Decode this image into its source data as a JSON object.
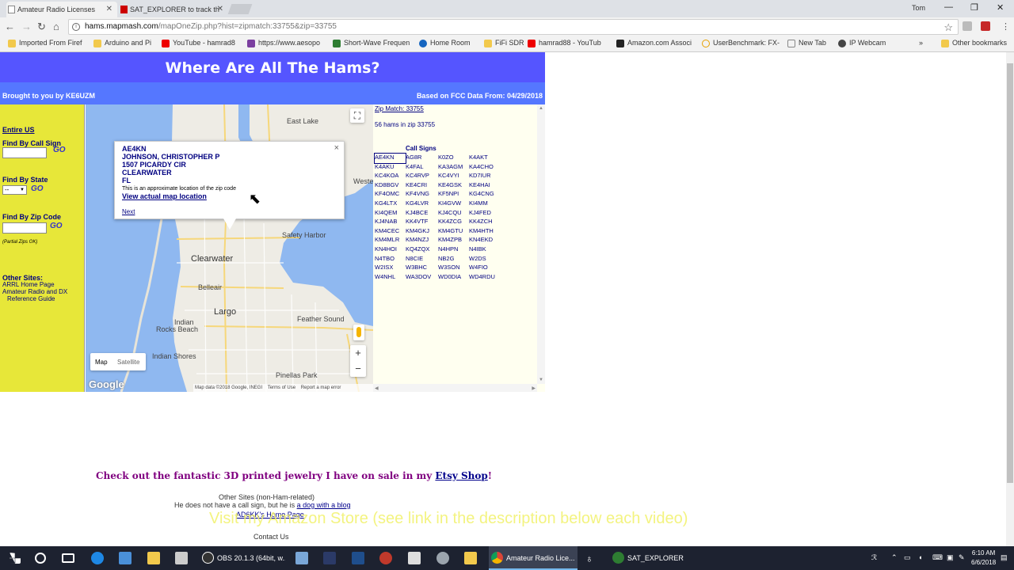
{
  "browser": {
    "tabs": [
      {
        "label": "Amateur Radio Licenses",
        "active": true
      },
      {
        "label": "SAT_EXPLORER to track th",
        "active": false
      }
    ],
    "user": "Tom",
    "url_host": "hams.mapmash.com",
    "url_rest": "/mapOneZip.php?hist=zipmatch:33755&zip=33755",
    "bookmarks": [
      "Imported From Firef",
      "Arduino and Pi",
      "YouTube - hamrad8",
      "https://www.aesopo",
      "Short-Wave Frequen",
      "Home Room",
      "FiFi SDR",
      "hamrad88 - YouTub",
      "Amazon.com Associ",
      "UserBenchmark: FX-",
      "New Tab",
      "IP Webcam"
    ],
    "bookmarks_more": "»",
    "other_bookmarks": "Other bookmarks"
  },
  "page": {
    "title": "Where Are All The Hams?",
    "brought_by": "Brought to you by KE6UZM",
    "fcc_date": "Based on FCC Data From: 04/29/2018",
    "sidebar": {
      "entire_us": "Entire US",
      "find_call": "Find By Call Sign",
      "find_state": "Find By State",
      "state_value": "--",
      "find_zip": "Find By Zip Code",
      "partial": "(Partial Zips OK)",
      "go": "GO",
      "other_sites": "Other Sites:",
      "links": [
        "ARRL Home Page",
        "Amateur Radio and DX",
        "Reference Guide"
      ]
    },
    "map": {
      "popup": {
        "call": "AE4KN",
        "name": "JOHNSON, CHRISTOPHER P",
        "address": "1507 PICARDY CIR",
        "city": "CLEARWATER",
        "state": "FL",
        "note": "This is an approximate location of the zip code",
        "view_link": "View actual map location",
        "next": "Next",
        "close": "×"
      },
      "labels": {
        "east_lake": "East Lake",
        "safety_harbor": "Safety Harbor",
        "clearwater": "Clearwater",
        "belleair": "Belleair",
        "largo": "Largo",
        "indian_rocks": "Indian",
        "indian_rocks_2": "Rocks Beach",
        "indian_shores": "Indian Shores",
        "feather_sound": "Feather Sound",
        "pinellas_park": "Pinellas Park",
        "west": "Weste"
      },
      "type_map": "Map",
      "type_satellite": "Satellite",
      "zoom_in": "+",
      "zoom_out": "−",
      "google": "Google",
      "attribution": "Map data ©2018 Google, INEGI",
      "terms": "Terms of Use",
      "report": "Report a map error"
    },
    "results": {
      "zip_match": "Zip Match: 33755",
      "count": "56 hams in zip 33755",
      "header": "Call Signs",
      "calls": [
        "AE4KN",
        "AG8R",
        "K0ZO",
        "K4AKT",
        "K4AKU",
        "K4FAL",
        "KA3AGM",
        "KA4CHO",
        "KC4KOA",
        "KC4RVP",
        "KC4VYI",
        "KD7IUR",
        "KD8BGV",
        "KE4CRI",
        "KE4GSK",
        "KE4HAI",
        "KF4OMC",
        "KF4VNG",
        "KF5NPI",
        "KG4CNG",
        "KG4LTX",
        "KG4LVR",
        "KI4GVW",
        "KI4MM",
        "KI4QEM",
        "KJ4BCE",
        "KJ4CQU",
        "KJ4FED",
        "KJ4NAB",
        "KK4VTF",
        "KK4ZCG",
        "KK4ZCH",
        "KM4CEC",
        "KM4GKJ",
        "KM4GTU",
        "KM4HTH",
        "KM4MLR",
        "KM4NZJ",
        "KM4ZPB",
        "KN4EKD",
        "KN4HOI",
        "KQ4ZQX",
        "N4HPN",
        "N4IBK",
        "N4TBO",
        "N8CIE",
        "NB2G",
        "W2DS",
        "W2ISX",
        "W3BHC",
        "W3SON",
        "W4FIO",
        "W4NHL",
        "WA3DOV",
        "WD0DIA",
        "WD4RDU"
      ]
    },
    "promo_text": "Check out the fantastic 3D printed jewelry I have on sale in my ",
    "promo_link": "Etsy Shop",
    "promo_end": "!",
    "footer": {
      "other_sites": "Other Sites (non-Ham-related)",
      "dog_text": "He does not have a call sign, but he is ",
      "dog_link": "a dog with a blog",
      "home_page": "AD6KK's Home Page",
      "contact": "Contact Us"
    },
    "overlay": "Visit my Amazon Store (see link in the description below each video)"
  },
  "taskbar": {
    "items": [
      {
        "label": "OBS 20.1.3 (64bit, w...",
        "active": false
      },
      {
        "label": "Amateur Radio Lice...",
        "active": true
      },
      {
        "label": "SAT_EXPLORER",
        "active": false
      }
    ],
    "time": "6:10 AM",
    "date": "6/6/2018"
  }
}
